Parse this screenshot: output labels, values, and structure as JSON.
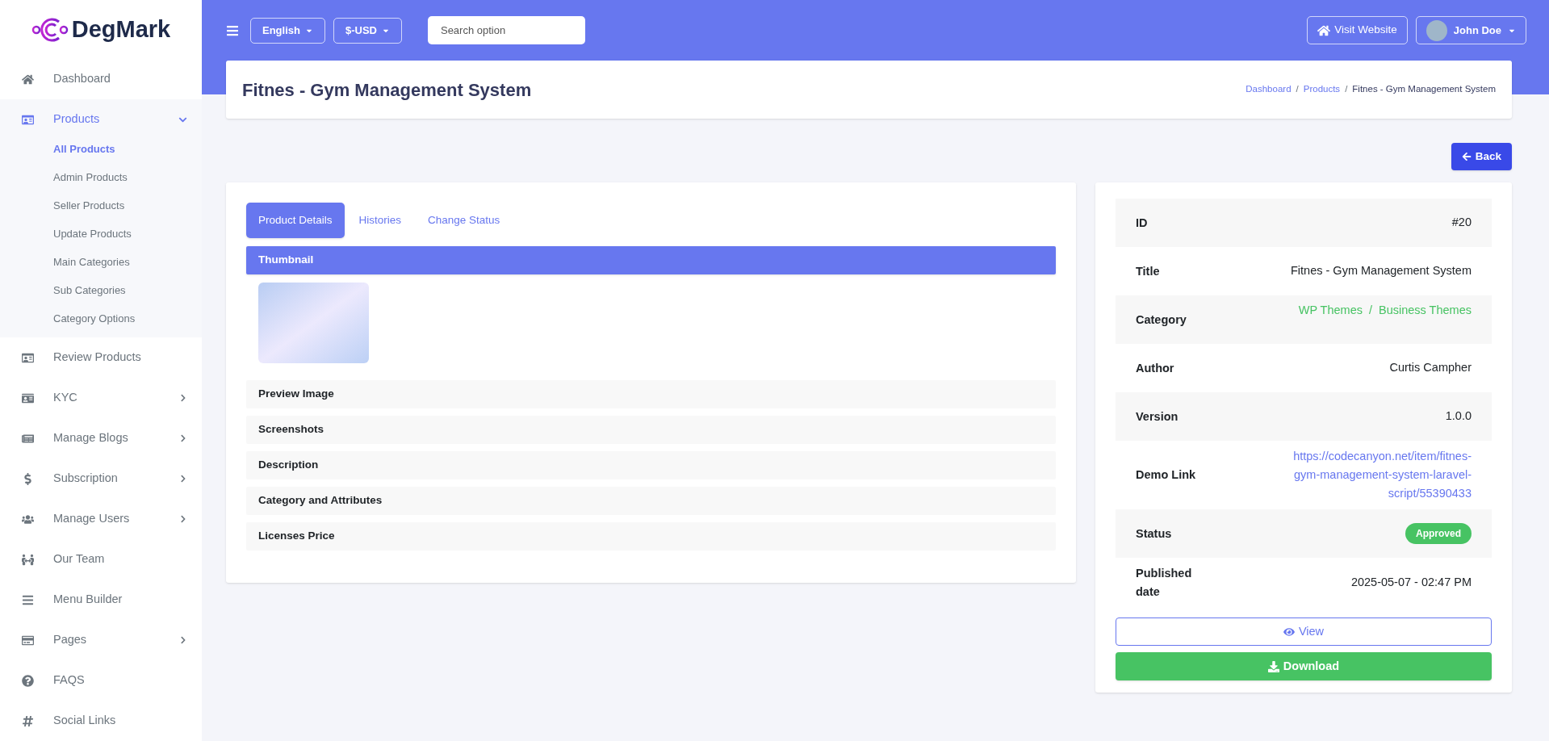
{
  "brand": {
    "name": "DegMark"
  },
  "sidebar": {
    "items": [
      {
        "label": "Dashboard",
        "selected": false
      },
      {
        "label": "Products",
        "selected": true,
        "expanded": true,
        "children": [
          {
            "label": "All Products",
            "selected": true
          },
          {
            "label": "Admin Products",
            "selected": false
          },
          {
            "label": "Seller Products",
            "selected": false
          },
          {
            "label": "Update Products",
            "selected": false
          },
          {
            "label": "Main Categories",
            "selected": false
          },
          {
            "label": "Sub Categories",
            "selected": false
          },
          {
            "label": "Category Options",
            "selected": false
          }
        ]
      },
      {
        "label": "Review Products",
        "selected": false
      },
      {
        "label": "KYC",
        "selected": false,
        "expanded": false
      },
      {
        "label": "Manage Blogs",
        "selected": false,
        "expanded": false
      },
      {
        "label": "Subscription",
        "selected": false,
        "expanded": false
      },
      {
        "label": "Manage Users",
        "selected": false,
        "expanded": false
      },
      {
        "label": "Our Team",
        "selected": false
      },
      {
        "label": "Menu Builder",
        "selected": false
      },
      {
        "label": "Pages",
        "selected": false,
        "expanded": false
      },
      {
        "label": "FAQS",
        "selected": false
      },
      {
        "label": "Social Links",
        "selected": false
      }
    ]
  },
  "topbar": {
    "language": "English",
    "currency": "$-USD",
    "search": {
      "placeholder": "Search option"
    },
    "visit_button": "Visit Website",
    "user": "John Doe"
  },
  "page": {
    "title": "Fitnes - Gym Management System",
    "breadcrumb": [
      {
        "label": "Dashboard",
        "link": true
      },
      {
        "separator": "/",
        "label": "Products",
        "link": true
      },
      {
        "separator": "/",
        "label": "Fitnes - Gym Management System",
        "link": false
      }
    ],
    "back_button": "Back"
  },
  "tabs": [
    {
      "label": "Product Details",
      "selected": true
    },
    {
      "label": "Histories",
      "selected": false
    },
    {
      "label": "Change Status",
      "selected": false
    }
  ],
  "sections": [
    {
      "title": "Thumbnail",
      "expanded": true
    },
    {
      "title": "Preview Image",
      "expanded": false
    },
    {
      "title": "Screenshots",
      "expanded": false
    },
    {
      "title": "Description",
      "expanded": false
    },
    {
      "title": "Category and Attributes",
      "expanded": false
    },
    {
      "title": "Licenses Price",
      "expanded": false
    }
  ],
  "details": [
    {
      "label": "ID",
      "kind": "text",
      "value": "#20"
    },
    {
      "label": "Title",
      "kind": "text",
      "value": "Fitnes - Gym Management System"
    },
    {
      "label": "Category",
      "kind": "links",
      "values": [
        "WP Themes",
        "Business Themes"
      ],
      "separator": "/"
    },
    {
      "label": "Author",
      "kind": "text",
      "value": "Curtis Campher"
    },
    {
      "label": "Version",
      "kind": "text",
      "value": "1.0.0"
    },
    {
      "label": "Demo Link",
      "kind": "link",
      "value": "https://codecanyon.net/item/fitnes-gym-management-system-laravel-script/55390433"
    },
    {
      "label": "Status",
      "kind": "badge",
      "value": "Approved"
    },
    {
      "label": "Published date",
      "kind": "text",
      "value": "2025-05-07 - 02:47 PM"
    }
  ],
  "actions": {
    "view": "View",
    "download": "Download"
  }
}
